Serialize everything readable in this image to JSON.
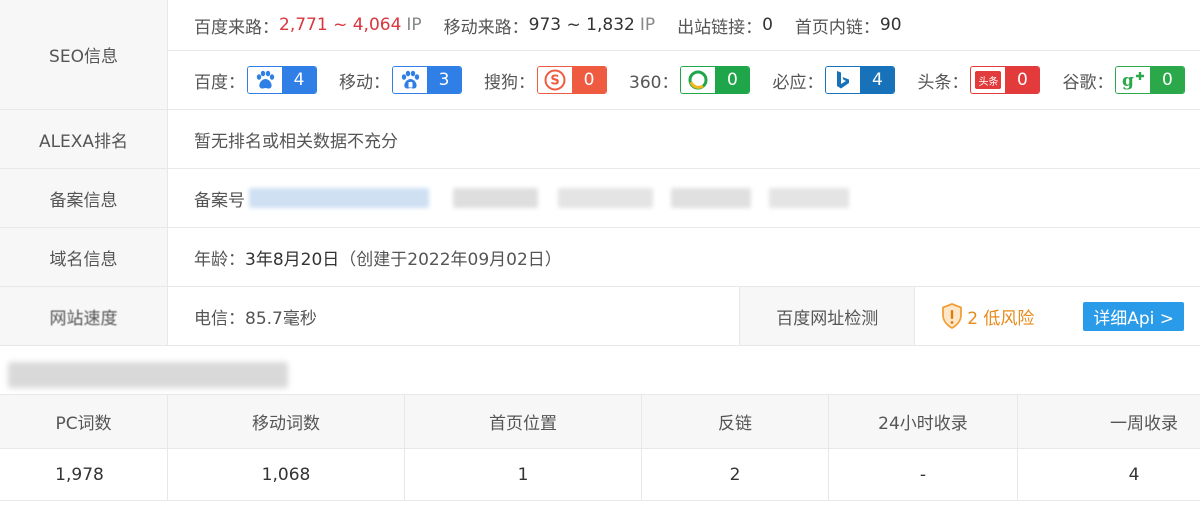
{
  "seo": {
    "label": "SEO信息",
    "baidu_traffic_label": "百度来路：",
    "baidu_traffic_value": "2,771 ~ 4,064",
    "ip_unit": "IP",
    "mobile_traffic_label": "移动来路：",
    "mobile_traffic_value": "973 ~ 1,832",
    "outbound_label": "出站链接：",
    "outbound_value": "0",
    "home_links_label": "首页内链：",
    "home_links_value": "90",
    "engines": [
      {
        "name": "百度：",
        "value": "4",
        "icon": "baidu-paw-icon",
        "color": "#2f7fe6"
      },
      {
        "name": "移动：",
        "value": "3",
        "icon": "baidu-mobile-paw-icon",
        "color": "#2f7fe6"
      },
      {
        "name": "搜狗：",
        "value": "0",
        "icon": "sogou-icon",
        "color": "#ee5b40"
      },
      {
        "name": "360：",
        "value": "0",
        "icon": "so360-icon",
        "color": "#1fa64a"
      },
      {
        "name": "必应：",
        "value": "4",
        "icon": "bing-icon",
        "color": "#1772ba"
      },
      {
        "name": "头条：",
        "value": "0",
        "icon": "toutiao-icon",
        "color": "#e33b3b"
      },
      {
        "name": "谷歌：",
        "value": "0",
        "icon": "google-plus-icon",
        "color": "#2aa84a"
      }
    ],
    "toutiao_icon_text": "头条"
  },
  "alexa": {
    "label": "ALEXA排名",
    "value": "暂无排名或相关数据不充分"
  },
  "icp": {
    "label": "备案信息",
    "prefix": "备案号"
  },
  "domain": {
    "label": "域名信息",
    "age_label": "年龄：",
    "age_value": "3年8月20日",
    "created": "（创建于2022年09月02日）"
  },
  "speed": {
    "label": "网站速度",
    "value": "电信：85.7毫秒",
    "baidu_check": "百度网址检测",
    "risk": "2 低风险",
    "api_button": "详细Api >"
  },
  "stats": {
    "headers": [
      "PC词数",
      "移动词数",
      "首页位置",
      "反链",
      "24小时收录",
      "一周收录"
    ],
    "values": [
      "1,978",
      "1,068",
      "1",
      "2",
      "-",
      "4"
    ]
  }
}
